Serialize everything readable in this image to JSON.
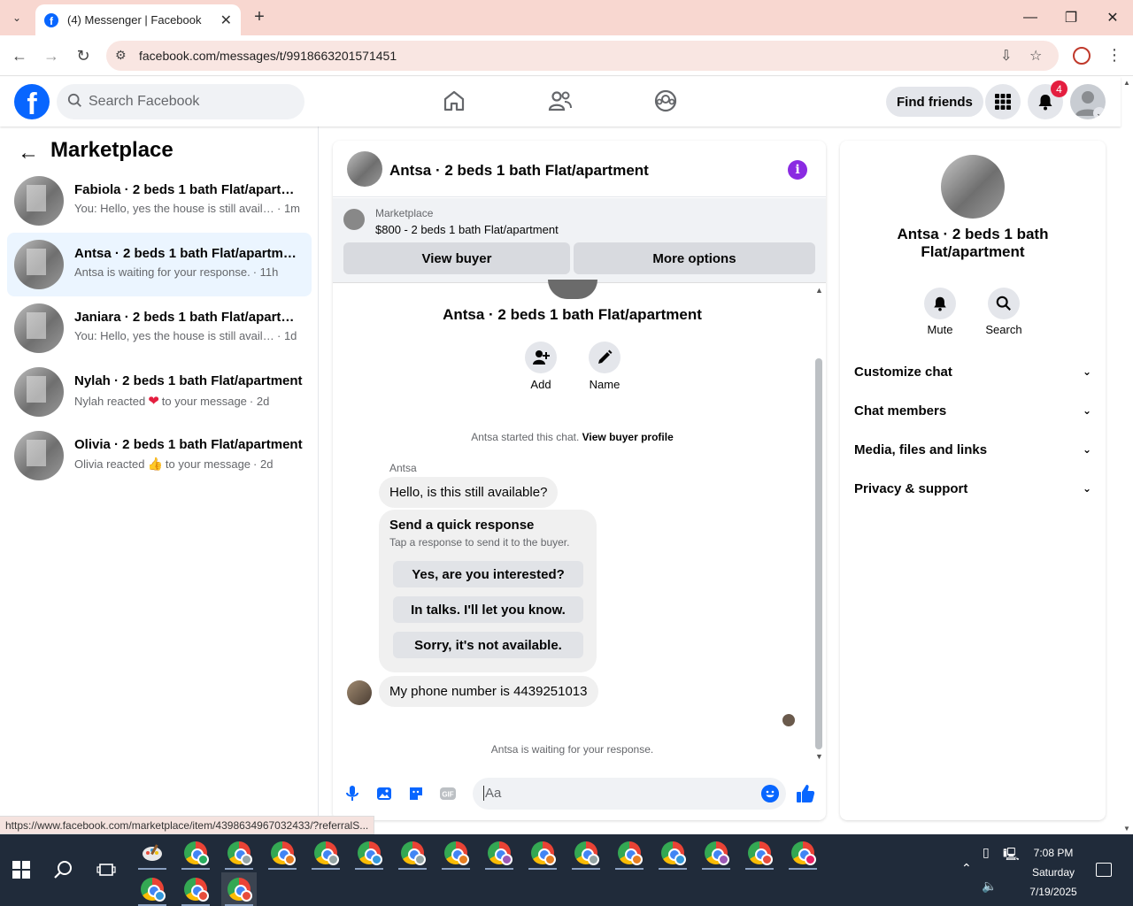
{
  "browser": {
    "tab_title": "(4) Messenger | Facebook",
    "url": "facebook.com/messages/t/9918663201571451",
    "status_url": "https://www.facebook.com/marketplace/item/4398634967032433/?referralS..."
  },
  "fb_header": {
    "search_placeholder": "Search Facebook",
    "find_friends": "Find friends",
    "notification_count": "4"
  },
  "sidebar": {
    "title": "Marketplace",
    "conversations": [
      {
        "name": "Fabiola · 2 beds 1 bath Flat/apartm...",
        "snippet": "You: Hello, yes the house is still availa...",
        "time": "· 1m",
        "active": false
      },
      {
        "name": "Antsa · 2 beds 1 bath Flat/apartment",
        "snippet": "Antsa is waiting for your response.",
        "time": "· 11h",
        "active": true
      },
      {
        "name": "Janiara · 2 beds 1 bath Flat/apartm...",
        "snippet": "You: Hello, yes the house is still availa...",
        "time": "· 1d",
        "active": false
      },
      {
        "name": "Nylah · 2 beds 1 bath Flat/apartment",
        "snippet_pre": "Nylah reacted",
        "reaction": "❤",
        "snippet_post": "to your message",
        "time": "· 2d",
        "active": false
      },
      {
        "name": "Olivia · 2 beds 1 bath Flat/apartment",
        "snippet_pre": "Olivia reacted",
        "reaction": "👍",
        "snippet_post": "to your message",
        "time": "· 2d",
        "active": false
      }
    ]
  },
  "chat": {
    "header_title": "Antsa · 2 beds 1 bath Flat/apartment",
    "marketplace_label": "Marketplace",
    "listing": "$800 - 2 beds 1 bath Flat/apartment",
    "view_buyer": "View buyer",
    "more_options": "More options",
    "profile_name": "Antsa · 2 beds 1 bath Flat/apartment",
    "add_label": "Add",
    "name_label": "Name",
    "started_text": "Antsa started this chat.",
    "view_buyer_profile": "View buyer profile",
    "sender": "Antsa",
    "message_1": "Hello, is this still available?",
    "quick_response_title": "Send a quick response",
    "quick_response_sub": "Tap a response to send it to the buyer.",
    "quick_responses": [
      "Yes, are you interested?",
      "In talks. I'll let you know.",
      "Sorry, it's not available."
    ],
    "message_2": "My phone number is 4439251013",
    "waiting": "Antsa is waiting for your response.",
    "composer_placeholder": "Aa"
  },
  "right_panel": {
    "name": "Antsa · 2 beds 1 bath Flat/apartment",
    "mute": "Mute",
    "search": "Search",
    "rows": [
      "Customize chat",
      "Chat members",
      "Media, files and links",
      "Privacy & support"
    ]
  },
  "taskbar": {
    "time": "7:08 PM",
    "day": "Saturday",
    "date": "7/19/2025"
  },
  "colors": {
    "fb_blue": "#0866ff",
    "active_conv": "#ebf5ff",
    "notif_red": "#e41e3f",
    "info_purple": "#8a2be2"
  }
}
